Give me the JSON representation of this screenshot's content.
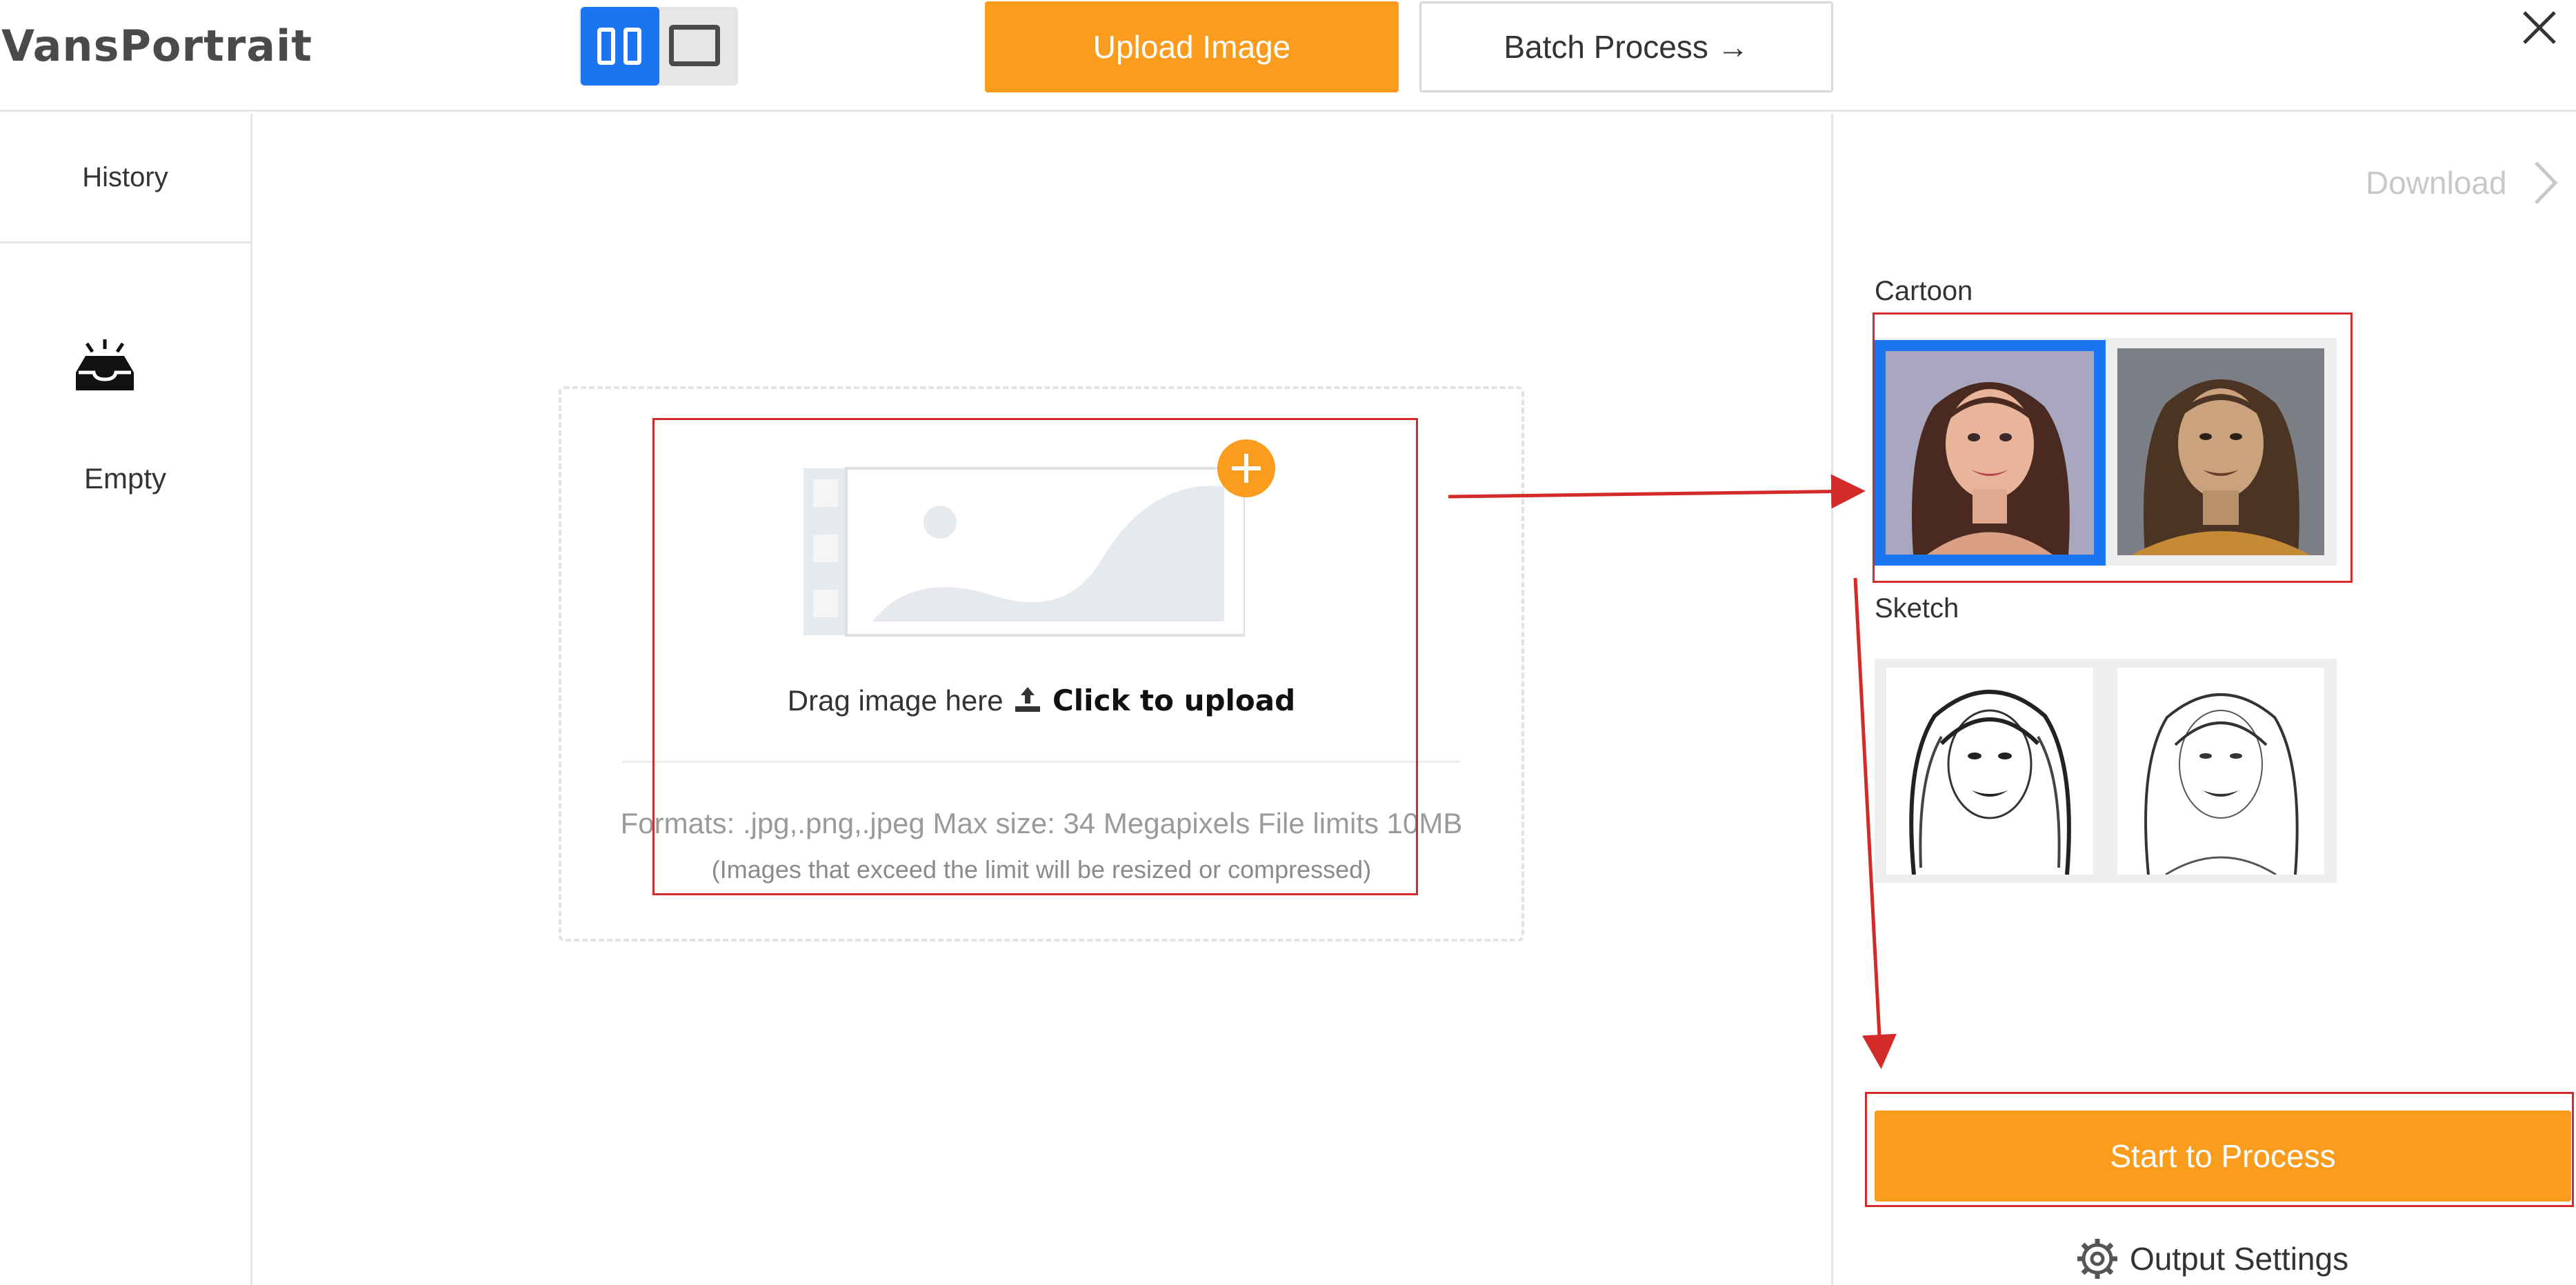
{
  "header": {
    "app_title": "VansPortrait",
    "upload_label": "Upload Image",
    "batch_label": "Batch Process →"
  },
  "sidebar": {
    "history_label": "History",
    "empty_label": "Empty"
  },
  "upload": {
    "drag_text": "Drag image here",
    "click_text": "Click to upload",
    "formats": "Formats: .jpg,.png,.jpeg Max size: 34 Megapixels File limits 10MB",
    "limit_note": "(Images that exceed the limit will be resized or compressed)"
  },
  "right_panel": {
    "download_label": "Download",
    "cartoon_label": "Cartoon",
    "sketch_label": "Sketch",
    "start_label": "Start to Process",
    "output_settings_label": "Output Settings"
  },
  "colors": {
    "accent": "#fa9c1e",
    "selected": "#1a76f0",
    "annotation": "#d32a2a"
  },
  "icons": [
    "layout-split-icon",
    "layout-single-icon",
    "close-icon",
    "empty-inbox-icon",
    "image-placeholder-icon",
    "add-icon",
    "upload-icon",
    "chevron-right-icon",
    "gear-icon"
  ]
}
